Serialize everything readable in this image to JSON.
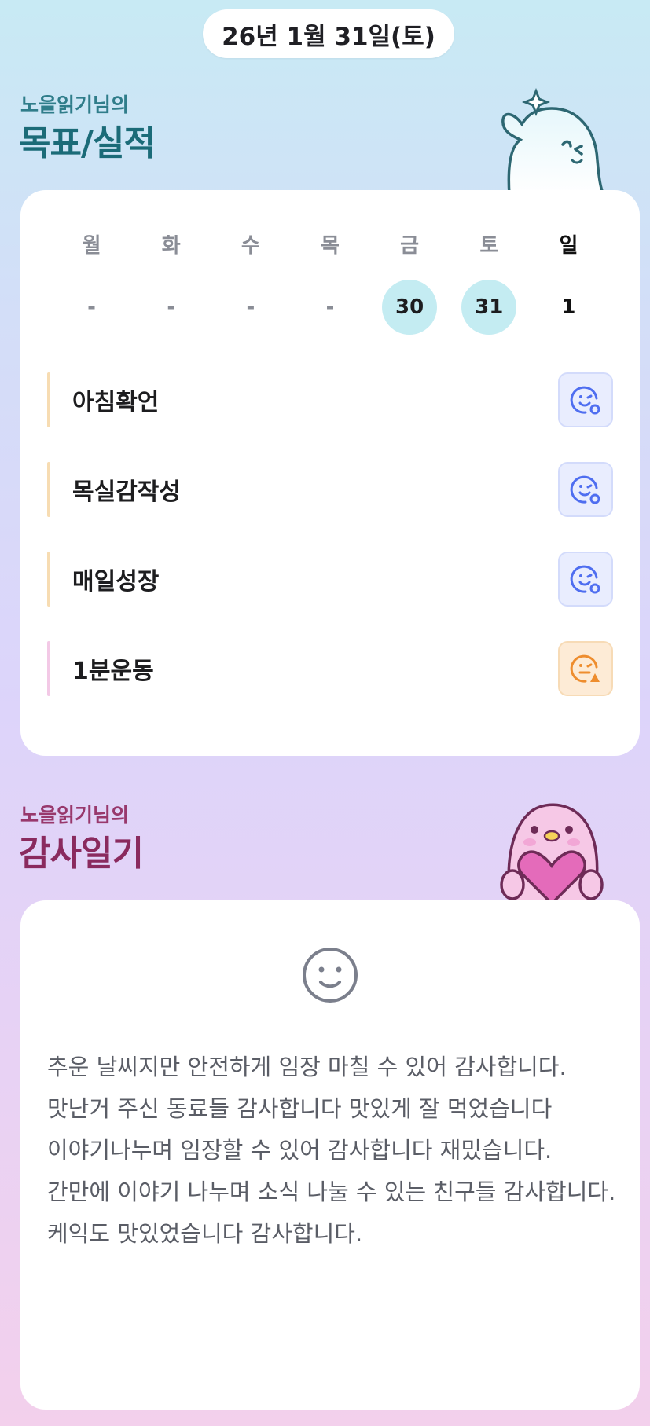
{
  "header": {
    "date": "26년 1월 31일(토)"
  },
  "goals_section": {
    "owner": "노을읽기님의",
    "title": "목표/실적"
  },
  "week": {
    "days": [
      "월",
      "화",
      "수",
      "목",
      "금",
      "토",
      "일"
    ],
    "dates": [
      "-",
      "-",
      "-",
      "-",
      "30",
      "31",
      "1"
    ]
  },
  "goals": [
    {
      "label": "아침확언",
      "status": "done",
      "icon": "smile-check-icon"
    },
    {
      "label": "목실감작성",
      "status": "done",
      "icon": "smile-check-icon"
    },
    {
      "label": "매일성장",
      "status": "done",
      "icon": "smile-check-icon"
    },
    {
      "label": "1분운동",
      "status": "warning",
      "icon": "smile-warning-icon"
    }
  ],
  "gratitude_section": {
    "owner": "노을읽기님의",
    "title": "감사일기"
  },
  "diary": {
    "mood_icon": "smile-face-icon",
    "text": "추운 날씨지만 안전하게 임장 마칠 수 있어 감사합니다.\n맛난거 주신 동료들 감사합니다 맛있게 잘 먹었습니다\n이야기나누며 임장할 수 있어 감사합니다 재밌습니다.\n간만에 이야기 나누며 소식 나눌 수 있는 친구들 감사합니다. 케익도 맛있었습니다 감사합니다."
  },
  "colors": {
    "accent_teal": "#1b6b78",
    "accent_berry": "#8a2a5e",
    "done_icon": "#4f6ef0",
    "warn_icon": "#ee8d2e",
    "selected_date_bg": "#c4ecf2"
  }
}
